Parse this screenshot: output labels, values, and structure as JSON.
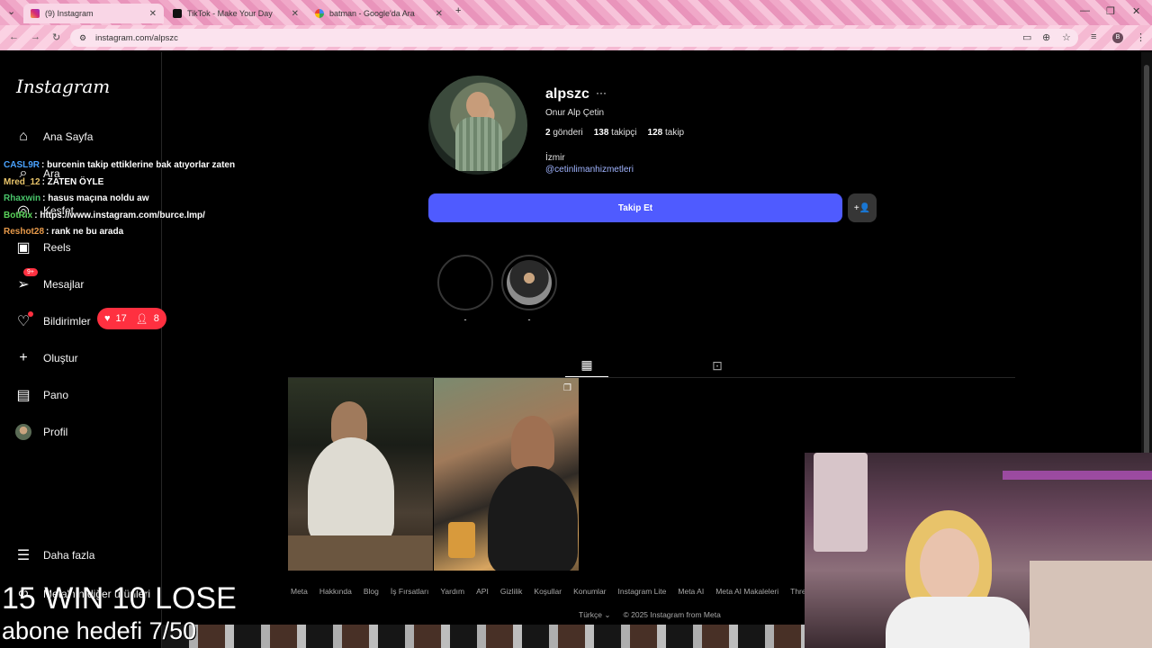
{
  "browser": {
    "tabs": [
      {
        "title": "(9) Instagram",
        "active": true
      },
      {
        "title": "TikTok - Make Your Day",
        "active": false
      },
      {
        "title": "batman - Google'da Ara",
        "active": false
      }
    ],
    "url": "instagram.com/alpszc",
    "profile_initial": "B"
  },
  "sidebar": {
    "logo": "Instagram",
    "items": [
      {
        "label": "Ana Sayfa",
        "icon": "home-icon"
      },
      {
        "label": "Ara",
        "icon": "search-icon"
      },
      {
        "label": "Keşfet",
        "icon": "explore-icon"
      },
      {
        "label": "Reels",
        "icon": "reels-icon"
      },
      {
        "label": "Mesajlar",
        "icon": "messenger-icon",
        "badge": "9+"
      },
      {
        "label": "Bildirimler",
        "icon": "heart-icon"
      },
      {
        "label": "Oluştur",
        "icon": "plus-icon"
      },
      {
        "label": "Pano",
        "icon": "dashboard-icon"
      },
      {
        "label": "Profil",
        "icon": "avatar-icon"
      },
      {
        "label": "Daha fazla",
        "icon": "menu-icon"
      },
      {
        "label": "Meta'nın diğer ürünleri",
        "icon": "meta-icon"
      }
    ],
    "notif_popup": {
      "likes": "17",
      "follows": "8"
    }
  },
  "profile": {
    "username": "alpszc",
    "more": "···",
    "full_name": "Onur Alp Çetin",
    "posts_count": "2",
    "posts_label": "gönderi",
    "followers_count": "138",
    "followers_label": "takipçi",
    "following_count": "128",
    "following_label": "takip",
    "city": "İzmir",
    "link": "@cetinlimanhizmetleri",
    "follow_button": "Takip Et",
    "suggest_icon": "+👤",
    "highlights": [
      {
        "label": "-"
      },
      {
        "label": "-"
      }
    ]
  },
  "footer": {
    "links": [
      "Meta",
      "Hakkında",
      "Blog",
      "İş Fırsatları",
      "Yardım",
      "API",
      "Gizlilik",
      "Koşullar",
      "Konumlar",
      "Instagram Lite",
      "Meta AI",
      "Meta AI Makaleleri",
      "Threads"
    ],
    "language": "Türkçe",
    "copyright": "© 2025 Instagram from Meta"
  },
  "stream": {
    "chat": [
      {
        "user": "CASL9R",
        "user_color": "#4aa3ff",
        "text": ": burcenin takip ettiklerine bak atıyorlar zaten"
      },
      {
        "user": "Mred_12",
        "user_color": "#e8c46a",
        "text": ": ZATEN ÖYLE"
      },
      {
        "user": "Rhaxwin",
        "user_color": "#49c46a",
        "text": ": hasus maçına noldu aw"
      },
      {
        "user": "BotRix",
        "user_color": "#5ad35a",
        "text": ": https://www.instagram.com/burce.lmp/"
      },
      {
        "user": "Reshot28",
        "user_color": "#e89a4a",
        "text": ": rank ne bu arada"
      }
    ],
    "overlay_main": "15 WIN 10 LOSE",
    "overlay_sub": "abone hedefi 7/50"
  }
}
